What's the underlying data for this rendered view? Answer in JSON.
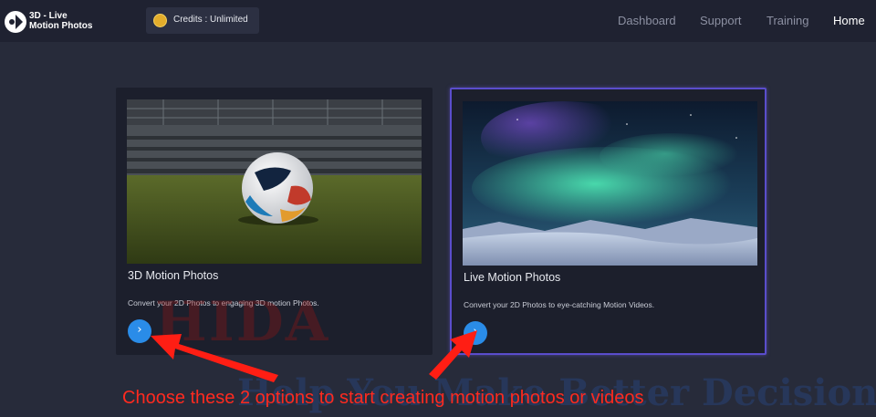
{
  "app": {
    "logo_line1": "3D - Live",
    "logo_line2": "Motion Photos"
  },
  "credits": {
    "label": "Credits : Unlimited",
    "icon": "coin-icon"
  },
  "nav": {
    "items": [
      {
        "label": "Dashboard",
        "active": false
      },
      {
        "label": "Support",
        "active": false
      },
      {
        "label": "Training",
        "active": false
      },
      {
        "label": "Home",
        "active": true
      }
    ]
  },
  "cards": [
    {
      "title": "3D Motion Photos",
      "description": "Convert your 2D Photos to engaging 3D motion Photos.",
      "button_icon": "chevron-right-icon",
      "image": "soccer-ball-stadium"
    },
    {
      "title": "Live Motion Photos",
      "description": "Convert your 2D Photos to eye-catching Motion Videos.",
      "button_icon": "chevron-right-icon",
      "image": "aurora-snow-landscape",
      "selected": true
    }
  ],
  "overlay": {
    "watermark_top": "HIDA",
    "watermark_bottom": "Help You Make Better Decisions",
    "caption": "Choose these 2 options to start creating motion photos or videos"
  },
  "colors": {
    "background": "#272b3a",
    "topbar": "#1f2231",
    "card": "#1c1f2c",
    "accent_button": "#2a8ce8",
    "selected_border": "#5a4dcc",
    "annotation_red": "#ff2a1f"
  }
}
